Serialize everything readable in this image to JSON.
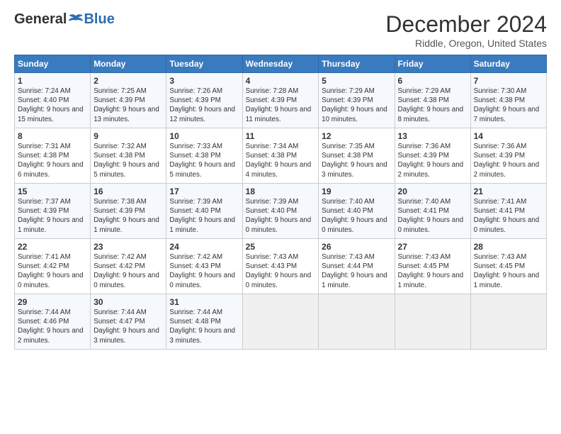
{
  "header": {
    "logo_general": "General",
    "logo_blue": "Blue",
    "month_title": "December 2024",
    "location": "Riddle, Oregon, United States"
  },
  "days_of_week": [
    "Sunday",
    "Monday",
    "Tuesday",
    "Wednesday",
    "Thursday",
    "Friday",
    "Saturday"
  ],
  "weeks": [
    [
      {
        "day": "1",
        "sunrise": "7:24 AM",
        "sunset": "4:40 PM",
        "daylight": "9 hours and 15 minutes."
      },
      {
        "day": "2",
        "sunrise": "7:25 AM",
        "sunset": "4:39 PM",
        "daylight": "9 hours and 13 minutes."
      },
      {
        "day": "3",
        "sunrise": "7:26 AM",
        "sunset": "4:39 PM",
        "daylight": "9 hours and 12 minutes."
      },
      {
        "day": "4",
        "sunrise": "7:28 AM",
        "sunset": "4:39 PM",
        "daylight": "9 hours and 11 minutes."
      },
      {
        "day": "5",
        "sunrise": "7:29 AM",
        "sunset": "4:39 PM",
        "daylight": "9 hours and 10 minutes."
      },
      {
        "day": "6",
        "sunrise": "7:29 AM",
        "sunset": "4:38 PM",
        "daylight": "9 hours and 8 minutes."
      },
      {
        "day": "7",
        "sunrise": "7:30 AM",
        "sunset": "4:38 PM",
        "daylight": "9 hours and 7 minutes."
      }
    ],
    [
      {
        "day": "8",
        "sunrise": "7:31 AM",
        "sunset": "4:38 PM",
        "daylight": "9 hours and 6 minutes."
      },
      {
        "day": "9",
        "sunrise": "7:32 AM",
        "sunset": "4:38 PM",
        "daylight": "9 hours and 5 minutes."
      },
      {
        "day": "10",
        "sunrise": "7:33 AM",
        "sunset": "4:38 PM",
        "daylight": "9 hours and 5 minutes."
      },
      {
        "day": "11",
        "sunrise": "7:34 AM",
        "sunset": "4:38 PM",
        "daylight": "9 hours and 4 minutes."
      },
      {
        "day": "12",
        "sunrise": "7:35 AM",
        "sunset": "4:38 PM",
        "daylight": "9 hours and 3 minutes."
      },
      {
        "day": "13",
        "sunrise": "7:36 AM",
        "sunset": "4:39 PM",
        "daylight": "9 hours and 2 minutes."
      },
      {
        "day": "14",
        "sunrise": "7:36 AM",
        "sunset": "4:39 PM",
        "daylight": "9 hours and 2 minutes."
      }
    ],
    [
      {
        "day": "15",
        "sunrise": "7:37 AM",
        "sunset": "4:39 PM",
        "daylight": "9 hours and 1 minute."
      },
      {
        "day": "16",
        "sunrise": "7:38 AM",
        "sunset": "4:39 PM",
        "daylight": "9 hours and 1 minute."
      },
      {
        "day": "17",
        "sunrise": "7:39 AM",
        "sunset": "4:40 PM",
        "daylight": "9 hours and 1 minute."
      },
      {
        "day": "18",
        "sunrise": "7:39 AM",
        "sunset": "4:40 PM",
        "daylight": "9 hours and 0 minutes."
      },
      {
        "day": "19",
        "sunrise": "7:40 AM",
        "sunset": "4:40 PM",
        "daylight": "9 hours and 0 minutes."
      },
      {
        "day": "20",
        "sunrise": "7:40 AM",
        "sunset": "4:41 PM",
        "daylight": "9 hours and 0 minutes."
      },
      {
        "day": "21",
        "sunrise": "7:41 AM",
        "sunset": "4:41 PM",
        "daylight": "9 hours and 0 minutes."
      }
    ],
    [
      {
        "day": "22",
        "sunrise": "7:41 AM",
        "sunset": "4:42 PM",
        "daylight": "9 hours and 0 minutes."
      },
      {
        "day": "23",
        "sunrise": "7:42 AM",
        "sunset": "4:42 PM",
        "daylight": "9 hours and 0 minutes."
      },
      {
        "day": "24",
        "sunrise": "7:42 AM",
        "sunset": "4:43 PM",
        "daylight": "9 hours and 0 minutes."
      },
      {
        "day": "25",
        "sunrise": "7:43 AM",
        "sunset": "4:43 PM",
        "daylight": "9 hours and 0 minutes."
      },
      {
        "day": "26",
        "sunrise": "7:43 AM",
        "sunset": "4:44 PM",
        "daylight": "9 hours and 1 minute."
      },
      {
        "day": "27",
        "sunrise": "7:43 AM",
        "sunset": "4:45 PM",
        "daylight": "9 hours and 1 minute."
      },
      {
        "day": "28",
        "sunrise": "7:43 AM",
        "sunset": "4:45 PM",
        "daylight": "9 hours and 1 minute."
      }
    ],
    [
      {
        "day": "29",
        "sunrise": "7:44 AM",
        "sunset": "4:46 PM",
        "daylight": "9 hours and 2 minutes."
      },
      {
        "day": "30",
        "sunrise": "7:44 AM",
        "sunset": "4:47 PM",
        "daylight": "9 hours and 3 minutes."
      },
      {
        "day": "31",
        "sunrise": "7:44 AM",
        "sunset": "4:48 PM",
        "daylight": "9 hours and 3 minutes."
      },
      null,
      null,
      null,
      null
    ]
  ]
}
